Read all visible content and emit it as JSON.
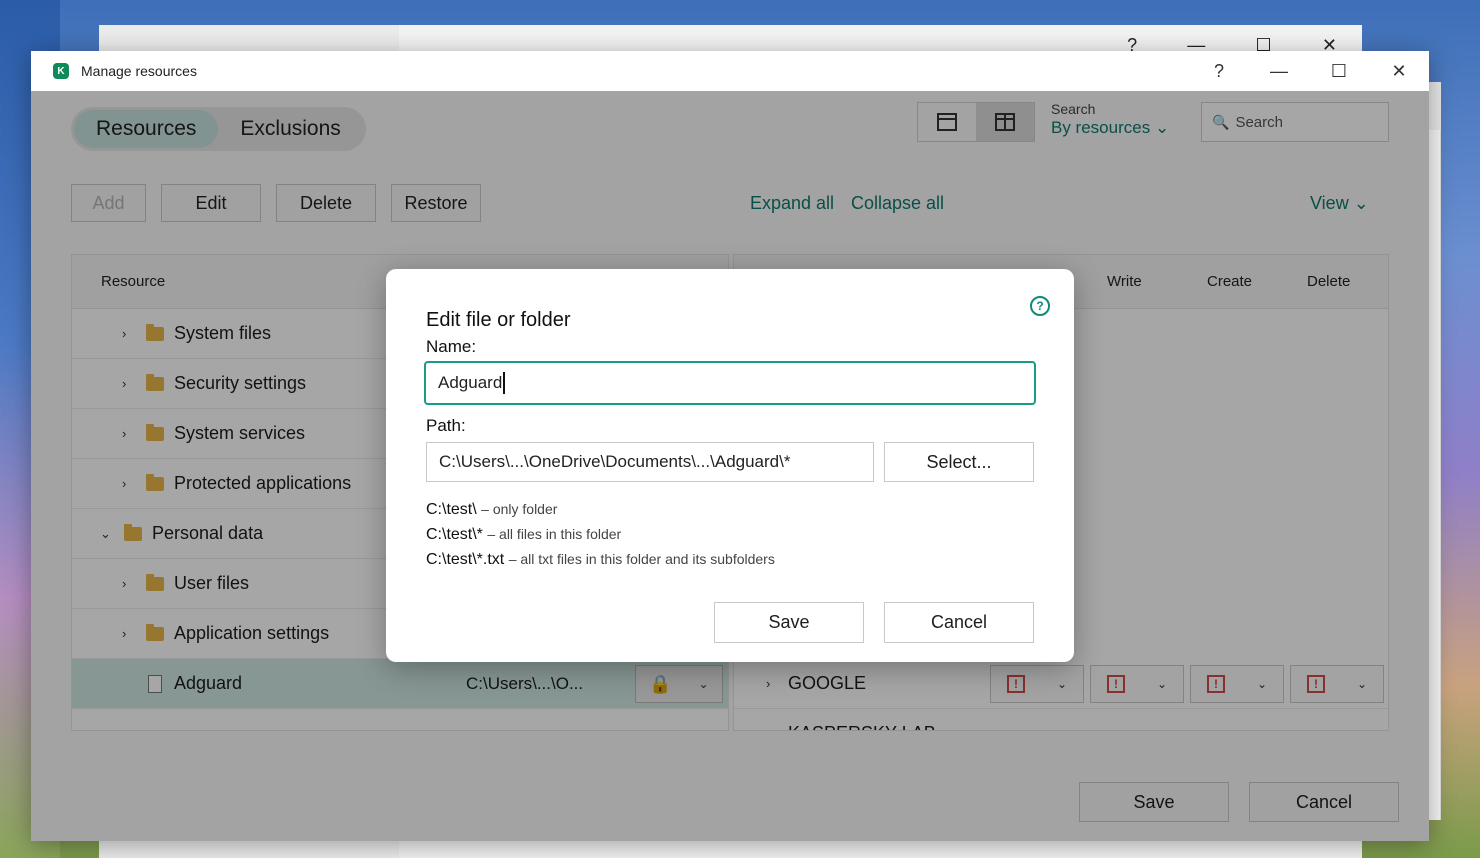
{
  "back_window": {
    "controls": [
      "?",
      "—",
      "☐",
      "✕"
    ]
  },
  "window": {
    "title": "Manage resources",
    "controls": {
      "help": "?",
      "minimize": "—",
      "maximize": "☐",
      "close": "✕"
    }
  },
  "tabs": {
    "resources": "Resources",
    "exclusions": "Exclusions"
  },
  "search": {
    "label": "Search",
    "mode": "By resources",
    "placeholder": "Search"
  },
  "toolbar": {
    "add": "Add",
    "edit": "Edit",
    "delete": "Delete",
    "restore": "Restore",
    "expand_all": "Expand all",
    "collapse_all": "Collapse all",
    "view": "View"
  },
  "grid": {
    "resource_header": "Resource",
    "right_headers": {
      "write": "Write",
      "create": "Create",
      "delete": "Delete"
    },
    "rows": [
      {
        "label": "System files"
      },
      {
        "label": "Security settings"
      },
      {
        "label": "System services"
      },
      {
        "label": "Protected applications"
      },
      {
        "label": "Personal data"
      },
      {
        "label": "User files"
      },
      {
        "label": "Application settings"
      },
      {
        "label": "Adguard",
        "path": "C:\\Users\\...\\O..."
      }
    ],
    "right_rows": {
      "google": "GOOGLE",
      "kaspersky": "KASPERSKY LAB"
    }
  },
  "footer": {
    "save": "Save",
    "cancel": "Cancel"
  },
  "dialog": {
    "title": "Edit file or folder",
    "name_label": "Name:",
    "name_value": "Adguard",
    "path_label": "Path:",
    "path_value": "C:\\Users\\...\\OneDrive\\Documents\\...\\Adguard\\*",
    "select_button": "Select...",
    "hints": [
      {
        "pattern": "C:\\test\\",
        "desc": "– only folder"
      },
      {
        "pattern": "C:\\test\\*",
        "desc": "– all files in this folder"
      },
      {
        "pattern": "C:\\test\\*.txt",
        "desc": "– all txt files in this folder and its subfolders"
      }
    ],
    "save": "Save",
    "cancel": "Cancel"
  }
}
